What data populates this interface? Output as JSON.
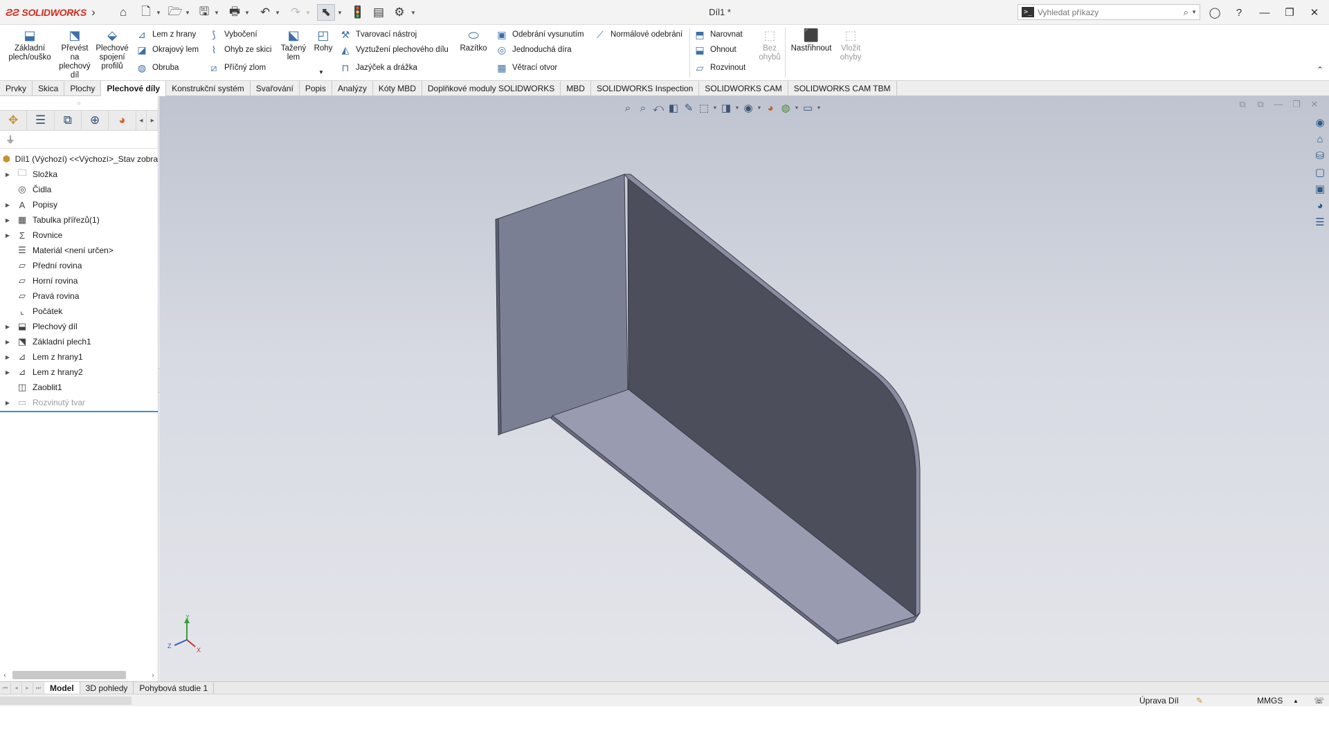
{
  "app": {
    "name": "SOLIDWORKS",
    "doc_title": "Díl1 *"
  },
  "search": {
    "placeholder": "Vyhledat příkazy"
  },
  "ribbon": {
    "zakladni": "Základní plech/ouško",
    "prevest": "Převést na plechový díl",
    "plechove_spojeni": "Plechové spojení profilů",
    "lem_z_hrany": "Lem z hrany",
    "okrajovy_lem": "Okrajový lem",
    "obruba": "Obruba",
    "vybočeni": "Vybočení",
    "ohyb_ze_skici": "Ohyb ze skici",
    "pricny_zlom": "Příčný zlom",
    "tazeny_lem": "Tažený lem",
    "rohy": "Rohy",
    "tvarovaci": "Tvarovací nástroj",
    "vyztuzeni": "Vyztužení plechového dílu",
    "jazycek": "Jazýček a drážka",
    "razitko": "Razítko",
    "odebrani_vysunutim": "Odebrání vysunutím",
    "jednoducha_dira": "Jednoduchá díra",
    "vetraci_otvor": "Větrací otvor",
    "normalove": "Normálové odebrání",
    "narovnat": "Narovnat",
    "ohnout": "Ohnout",
    "rozvinout": "Rozvinout",
    "bez_ohybu": "Bez ohybů",
    "nastrihnout": "Nastřihnout",
    "vlozit_ohyby": "Vložit ohyby"
  },
  "tabs": [
    "Prvky",
    "Skica",
    "Plochy",
    "Plechové díly",
    "Konstrukční systém",
    "Svařování",
    "Popis",
    "Analýzy",
    "Kóty MBD",
    "Doplňkové moduly SOLIDWORKS",
    "MBD",
    "SOLIDWORKS Inspection",
    "SOLIDWORKS CAM",
    "SOLIDWORKS CAM TBM"
  ],
  "active_tab": "Plechové díly",
  "tree": {
    "root": "Díl1 (Výchozí) <<Výchozí>_Stav zobra",
    "items": [
      {
        "label": "Složka",
        "icon": "folder-icon"
      },
      {
        "label": "Čidla",
        "icon": "sensor-icon"
      },
      {
        "label": "Popisy",
        "icon": "annotations-icon"
      },
      {
        "label": "Tabulka přířezů(1)",
        "icon": "cutlist-icon"
      },
      {
        "label": "Rovnice",
        "icon": "equations-icon"
      },
      {
        "label": "Materiál <není určen>",
        "icon": "material-icon"
      },
      {
        "label": "Přední rovina",
        "icon": "plane-icon"
      },
      {
        "label": "Horní rovina",
        "icon": "plane-icon"
      },
      {
        "label": "Pravá rovina",
        "icon": "plane-icon"
      },
      {
        "label": "Počátek",
        "icon": "origin-icon"
      },
      {
        "label": "Plechový díl",
        "icon": "sheetmetal-icon"
      },
      {
        "label": "Základní plech1",
        "icon": "base-flange-icon"
      },
      {
        "label": "Lem z hrany1",
        "icon": "edge-flange-icon"
      },
      {
        "label": "Lem z hrany2",
        "icon": "edge-flange-icon"
      },
      {
        "label": "Zaoblit1",
        "icon": "fillet-icon"
      },
      {
        "label": "Rozvinutý tvar",
        "icon": "flat-pattern-icon"
      }
    ]
  },
  "bottom_tabs": [
    "Model",
    "3D pohledy",
    "Pohybová studie 1"
  ],
  "status": {
    "mode": "Úprava Díl",
    "units": "MMGS"
  },
  "colors": {
    "accent": "#3b8fcf",
    "brand": "#d52b1e",
    "model_light": "#9a9cb0",
    "model_dark": "#4d4f5e"
  }
}
